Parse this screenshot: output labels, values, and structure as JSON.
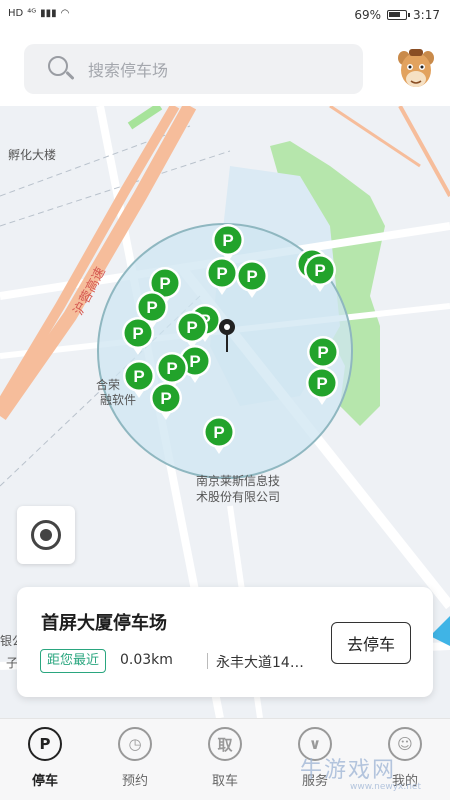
{
  "status_bar": {
    "network": "HD",
    "signal": "⁴ᴳ",
    "battery_percent": "69%",
    "time": "3:17"
  },
  "search": {
    "placeholder": "搜索停车场"
  },
  "map": {
    "labels": {
      "incubator": "孵化大楼",
      "expressway": "沪蓉高速",
      "left_building_line1": "合荣",
      "left_building_line2": "融软件",
      "company_line1": "南京莱斯信息技",
      "company_line2": "术股份有限公司",
      "left_edge_line1": "银公",
      "left_edge_line2": "子"
    },
    "parking_marker_label": "P",
    "colors": {
      "marker": "#22a32b",
      "circle_fill": "#cfe6f2",
      "circle_stroke": "#8fb7c0",
      "park": "#a7e39a",
      "highway": "#f6bd9b"
    }
  },
  "card": {
    "title": "首屏大厦停车场",
    "badge": "距您最近",
    "distance": "0.03km",
    "address": "永丰大道14…",
    "action": "去停车"
  },
  "nav": {
    "items": [
      {
        "label": "停车",
        "icon": "P"
      },
      {
        "label": "预约",
        "icon": "◷"
      },
      {
        "label": "取车",
        "icon": "取"
      },
      {
        "label": "服务",
        "icon": "∨"
      },
      {
        "label": "我的",
        "icon": "☺"
      }
    ]
  },
  "watermark": {
    "text": "牛游戏网",
    "sub": "www.newyx.net"
  }
}
